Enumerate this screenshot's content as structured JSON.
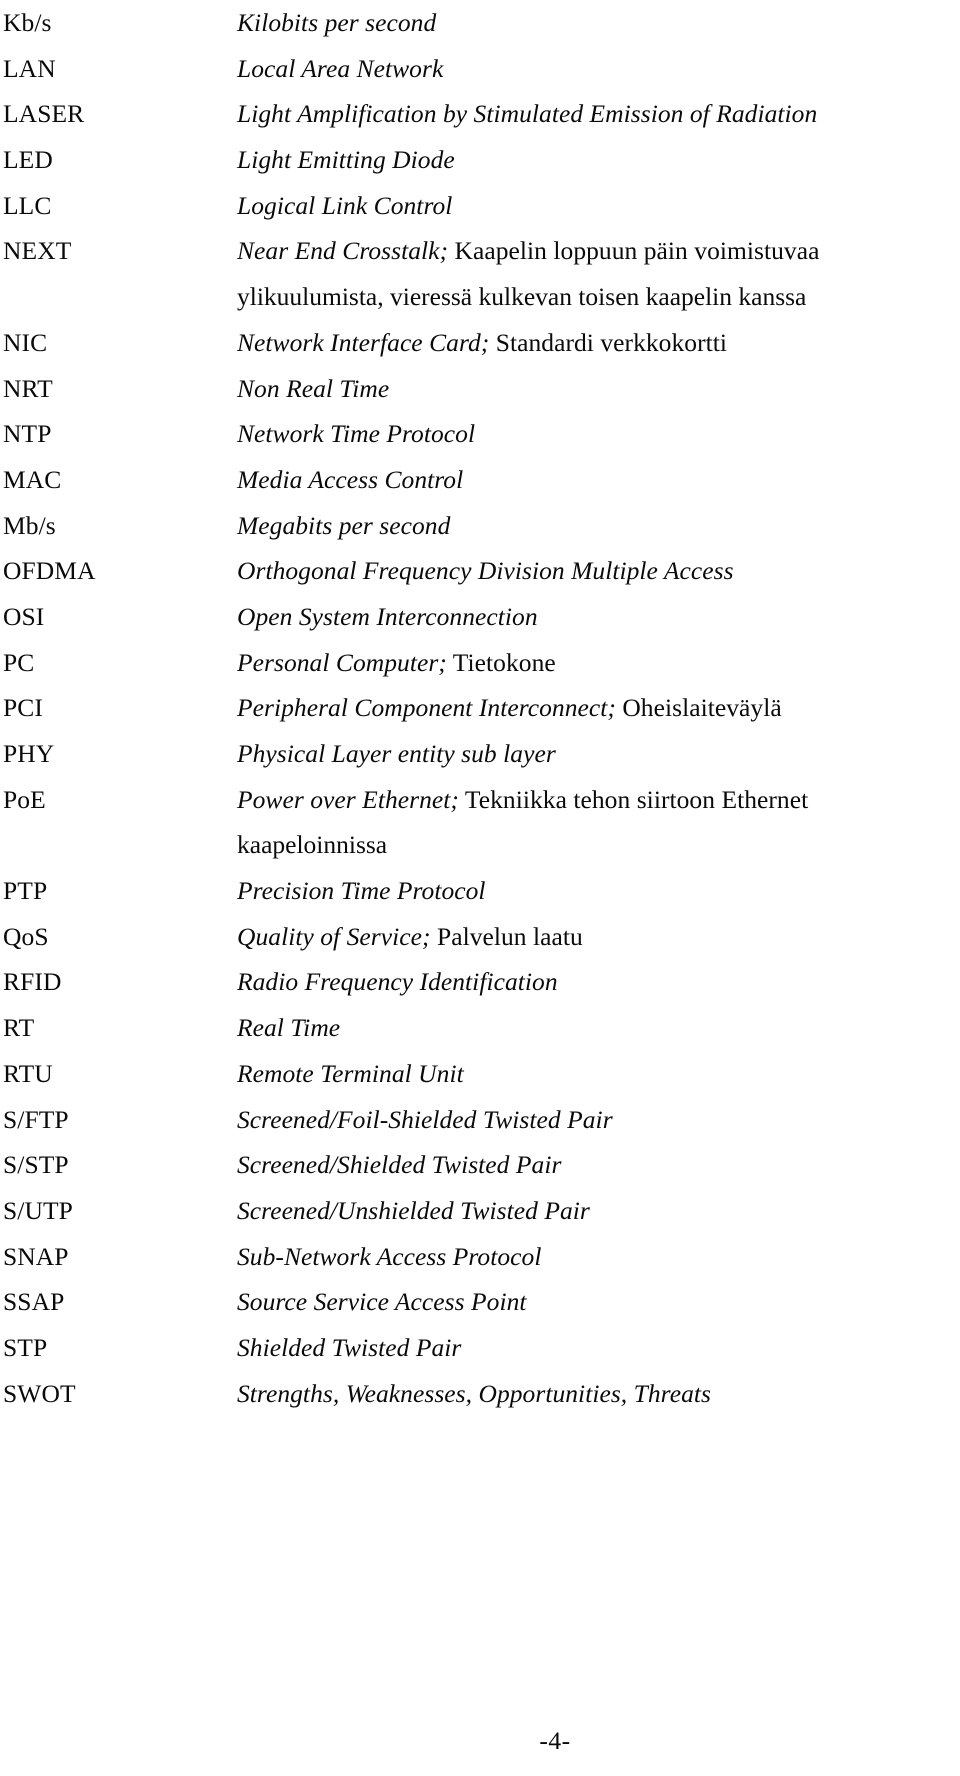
{
  "document": {
    "page_number_label": "-4-",
    "entries": [
      {
        "abbr": "Kb/s",
        "definition": "Kilobits per second",
        "finnish": ""
      },
      {
        "abbr": "LAN",
        "definition": "Local Area Network",
        "finnish": ""
      },
      {
        "abbr": "LASER",
        "definition": "Light Amplification by Stimulated Emission of Radiation",
        "finnish": ""
      },
      {
        "abbr": "LED",
        "definition": "Light Emitting Diode",
        "finnish": ""
      },
      {
        "abbr": "LLC",
        "definition": "Logical Link Control",
        "finnish": ""
      },
      {
        "abbr": "NEXT",
        "definition": "Near End Crosstalk;",
        "finnish": " Kaapelin loppuun päin voimistuvaa",
        "continuation": "ylikuulumista, vieressä kulkevan toisen kaapelin kanssa"
      },
      {
        "abbr": "NIC",
        "definition": "Network Interface Card;",
        "finnish": " Standardi verkkokortti"
      },
      {
        "abbr": "NRT",
        "definition": "Non Real Time",
        "finnish": ""
      },
      {
        "abbr": "NTP",
        "definition": "Network Time Protocol",
        "finnish": ""
      },
      {
        "abbr": "MAC",
        "definition": "Media Access Control",
        "finnish": ""
      },
      {
        "abbr": "Mb/s",
        "definition": "Megabits per second",
        "finnish": ""
      },
      {
        "abbr": "OFDMA",
        "definition": "Orthogonal Frequency Division Multiple Access",
        "finnish": ""
      },
      {
        "abbr": "OSI",
        "definition": "Open System Interconnection",
        "finnish": ""
      },
      {
        "abbr": "PC",
        "definition": "Personal Computer;",
        "finnish": " Tietokone"
      },
      {
        "abbr": "PCI",
        "definition": "Peripheral Component Interconnect;",
        "finnish": " Oheislaiteväylä"
      },
      {
        "abbr": "PHY",
        "definition": "Physical Layer entity sub layer",
        "finnish": ""
      },
      {
        "abbr": "PoE",
        "definition": "Power over Ethernet;",
        "finnish": " Tekniikka tehon siirtoon Ethernet",
        "continuation": "kaapeloinnissa"
      },
      {
        "abbr": "PTP",
        "definition": "Precision Time Protocol",
        "finnish": ""
      },
      {
        "abbr": "QoS",
        "definition": "Quality of Service;",
        "finnish": " Palvelun laatu"
      },
      {
        "abbr": "RFID",
        "definition": "Radio Frequency Identification",
        "finnish": ""
      },
      {
        "abbr": "RT",
        "definition": "Real Time",
        "finnish": ""
      },
      {
        "abbr": "RTU",
        "definition": "Remote Terminal Unit",
        "finnish": ""
      },
      {
        "abbr": "S/FTP",
        "definition": "Screened/Foil-Shielded Twisted Pair",
        "finnish": ""
      },
      {
        "abbr": "S/STP",
        "definition": "Screened/Shielded Twisted Pair",
        "finnish": ""
      },
      {
        "abbr": "S/UTP",
        "definition": "Screened/Unshielded Twisted Pair",
        "finnish": ""
      },
      {
        "abbr": "SNAP",
        "definition": "Sub-Network Access Protocol",
        "finnish": ""
      },
      {
        "abbr": "SSAP",
        "definition": "Source Service Access Point",
        "finnish": ""
      },
      {
        "abbr": "STP",
        "definition": "Shielded Twisted Pair",
        "finnish": ""
      },
      {
        "abbr": "SWOT",
        "definition": "Strengths, Weaknesses, Opportunities, Threats",
        "finnish": ""
      }
    ]
  }
}
